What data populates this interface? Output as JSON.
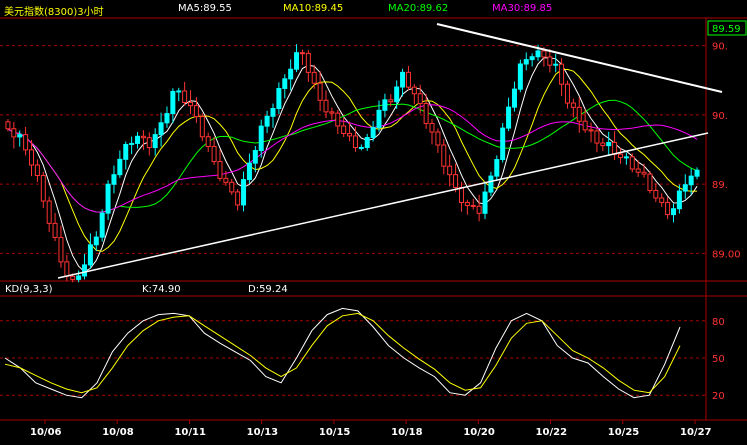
{
  "header": {
    "title": "美元指数(8300)3小时",
    "title_color": "#ffff00",
    "ma": [
      {
        "label": "MA5:89.55",
        "color": "#ffffff"
      },
      {
        "label": "MA10:89.45",
        "color": "#ffff00"
      },
      {
        "label": "MA20:89.62",
        "color": "#00ff00"
      },
      {
        "label": "MA30:89.85",
        "color": "#ff00ff"
      }
    ]
  },
  "kd_header": {
    "label": "KD(9,3,3)",
    "k": "K:74.90",
    "d": "D:59.24"
  },
  "price_axis": {
    "current": "89.59",
    "ticks": [
      "90.",
      "90.",
      "89.",
      "89.00"
    ],
    "tick_values": [
      90.5,
      90.0,
      89.5,
      89.0
    ],
    "color": "#ff3333"
  },
  "kd_axis": {
    "ticks": [
      "80",
      "50",
      "20"
    ],
    "tick_values": [
      80,
      50,
      20
    ]
  },
  "date_labels": [
    "10/06",
    "10/08",
    "10/11",
    "10/13",
    "10/15",
    "10/18",
    "10/20",
    "10/22",
    "10/25",
    "10/27"
  ],
  "colors": {
    "up": "#00ffff",
    "down": "#ff3333",
    "ma5": "#ffffff",
    "ma10": "#ffff00",
    "ma20": "#00ff00",
    "ma30": "#ff00ff",
    "k": "#ffffff",
    "d": "#ffff00",
    "grid": "#aa0000",
    "trend": "#ffffff"
  },
  "chart_data": [
    {
      "type": "candlestick",
      "title": "美元指数(8300)3小时",
      "x": [
        "10/06",
        "10/08",
        "10/11",
        "10/13",
        "10/15",
        "10/18",
        "10/20",
        "10/22",
        "10/25",
        "10/27"
      ],
      "ylim": [
        88.8,
        90.7
      ],
      "close_path": [
        89.9,
        89.8,
        89.6,
        89.3,
        89.0,
        88.8,
        88.95,
        89.15,
        89.5,
        89.7,
        89.85,
        89.8,
        89.95,
        90.2,
        90.1,
        89.9,
        89.65,
        89.5,
        89.4,
        89.7,
        89.95,
        90.1,
        90.3,
        90.45,
        90.2,
        90.05,
        89.95,
        89.8,
        89.75,
        90.0,
        90.1,
        90.3,
        90.15,
        89.95,
        89.7,
        89.45,
        89.3,
        89.3,
        89.6,
        90.0,
        90.35,
        90.45,
        90.4,
        90.3,
        90.05,
        89.95,
        89.85,
        89.8,
        89.7,
        89.6,
        89.5,
        89.35,
        89.3,
        89.55,
        89.6
      ]
    },
    {
      "type": "line",
      "title": "KD(9,3,3)",
      "ylim": [
        0,
        100
      ],
      "series": [
        {
          "name": "K",
          "values": [
            50,
            42,
            30,
            25,
            20,
            18,
            30,
            55,
            70,
            80,
            85,
            86,
            84,
            70,
            62,
            55,
            48,
            35,
            30,
            50,
            72,
            85,
            90,
            88,
            75,
            60,
            50,
            42,
            35,
            22,
            20,
            30,
            58,
            80,
            86,
            80,
            60,
            50,
            46,
            35,
            25,
            18,
            20,
            45,
            75
          ]
        },
        {
          "name": "D",
          "values": [
            45,
            42,
            36,
            30,
            25,
            22,
            26,
            42,
            60,
            72,
            80,
            83,
            84,
            76,
            68,
            60,
            52,
            42,
            35,
            42,
            60,
            76,
            84,
            86,
            80,
            68,
            58,
            49,
            41,
            30,
            24,
            26,
            44,
            66,
            78,
            80,
            68,
            56,
            50,
            42,
            32,
            24,
            22,
            35,
            60
          ]
        }
      ]
    }
  ]
}
